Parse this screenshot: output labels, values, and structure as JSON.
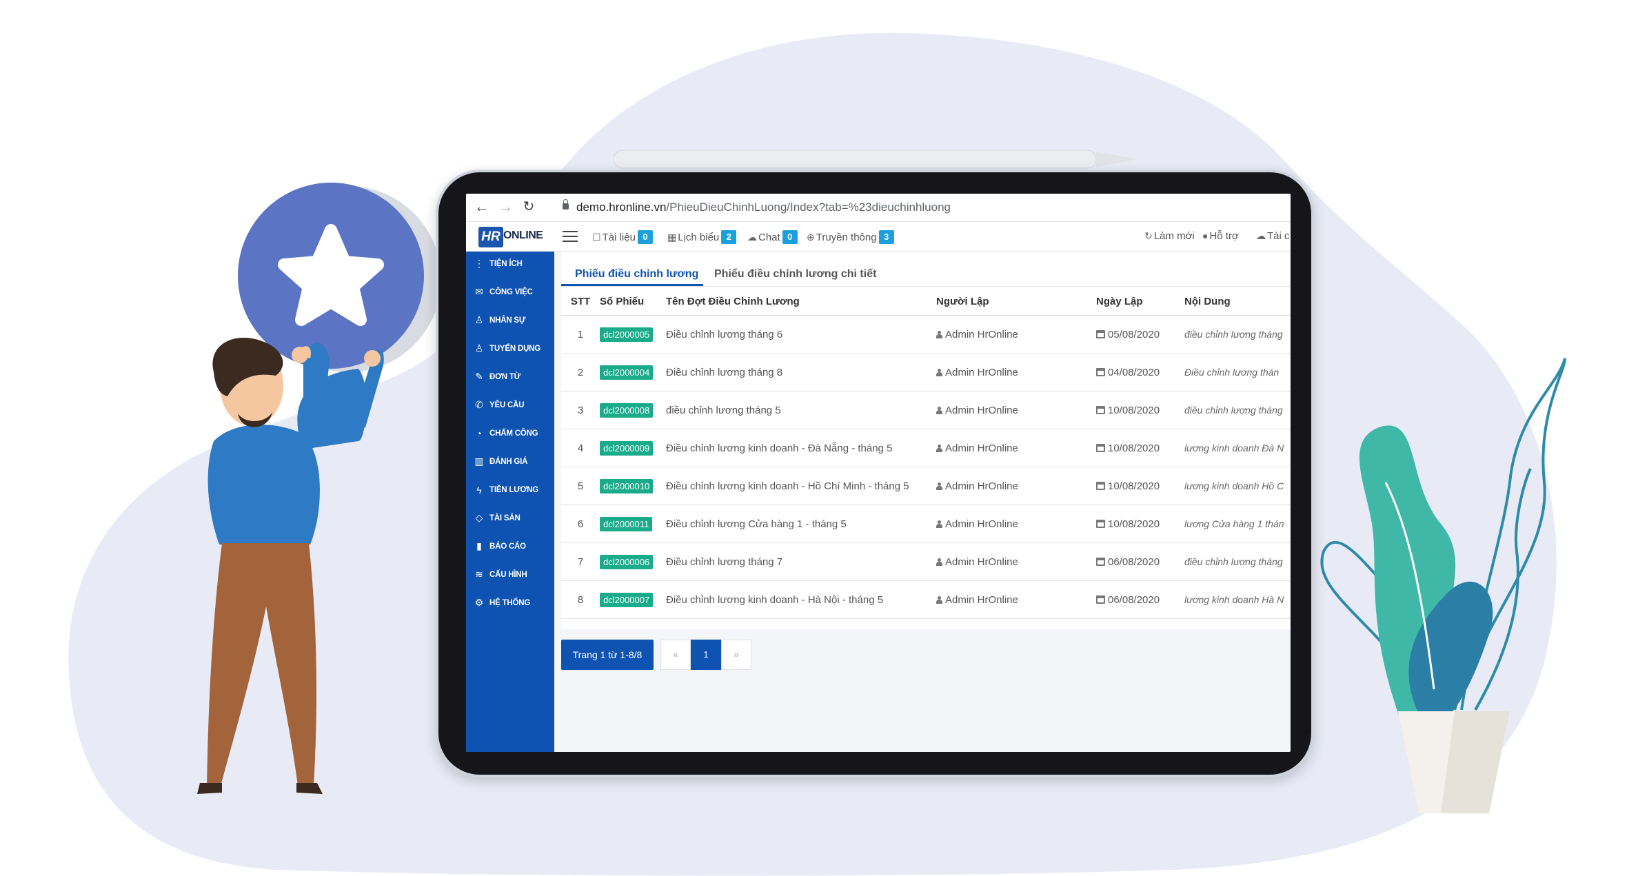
{
  "browser": {
    "url_host": "demo.hronline.vn",
    "url_path": "/PhieuDieuChinhLuong/Index?tab=%23dieuchinhluong"
  },
  "header": {
    "logo_mark": "HR",
    "logo_text": "ONLINE",
    "links": [
      {
        "label": "Tài liệu",
        "icon": "folder-icon",
        "badge": "0"
      },
      {
        "label": "Lịch biểu",
        "icon": "calendar-icon",
        "badge": "2"
      },
      {
        "label": "Chat",
        "icon": "chat-icon",
        "badge": "0"
      },
      {
        "label": "Truyền thông",
        "icon": "globe-icon",
        "badge": "3"
      }
    ],
    "right_links": [
      {
        "label": "Làm mới",
        "icon": "refresh-icon"
      },
      {
        "label": "Hỗ trợ",
        "icon": "info-icon"
      },
      {
        "label": "Tài c",
        "icon": "cloud-icon"
      }
    ]
  },
  "sidebar": {
    "items": [
      {
        "label": "Tiện ích",
        "icon": "more-vertical-icon"
      },
      {
        "label": "Công việc",
        "icon": "mail-icon"
      },
      {
        "label": "Nhân sự",
        "icon": "user-icon"
      },
      {
        "label": "Tuyển dụng",
        "icon": "user-add-icon"
      },
      {
        "label": "Đơn từ",
        "icon": "edit-icon"
      },
      {
        "label": "Yêu cầu",
        "icon": "phone-icon"
      },
      {
        "label": "Chấm công",
        "icon": "clock-icon"
      },
      {
        "label": "Đánh giá",
        "icon": "book-icon"
      },
      {
        "label": "Tiền lương",
        "icon": "bolt-icon"
      },
      {
        "label": "Tài sản",
        "icon": "diamond-icon"
      },
      {
        "label": "Báo cáo",
        "icon": "bar-chart-icon"
      },
      {
        "label": "Cấu hình",
        "icon": "layers-icon"
      },
      {
        "label": "Hệ thống",
        "icon": "gear-icon"
      }
    ]
  },
  "tabs": [
    {
      "label": "Phiếu điều chỉnh lương",
      "active": true
    },
    {
      "label": "Phiếu điều chỉnh lương chi tiết",
      "active": false
    }
  ],
  "table": {
    "headers": [
      "STT",
      "Số Phiếu",
      "Tên Đợt Điều Chỉnh Lương",
      "Người Lập",
      "Ngày Lập",
      "Nội Dung"
    ],
    "rows": [
      {
        "stt": "1",
        "code": "dcl2000005",
        "name": "Điều chỉnh lương tháng 6",
        "creator": "Admin HrOnline",
        "date": "05/08/2020",
        "content": "điều chỉnh lương tháng"
      },
      {
        "stt": "2",
        "code": "dcl2000004",
        "name": "Điều chỉnh lương tháng 8",
        "creator": "Admin HrOnline",
        "date": "04/08/2020",
        "content": "Điều chỉnh lương thán"
      },
      {
        "stt": "3",
        "code": "dcl2000008",
        "name": "điều chỉnh lương tháng 5",
        "creator": "Admin HrOnline",
        "date": "10/08/2020",
        "content": "điều chỉnh lương tháng"
      },
      {
        "stt": "4",
        "code": "dcl2000009",
        "name": "Điều chỉnh lương kinh doanh - Đà Nẵng - tháng 5",
        "creator": "Admin HrOnline",
        "date": "10/08/2020",
        "content": "lương kinh doanh Đà N"
      },
      {
        "stt": "5",
        "code": "dcl2000010",
        "name": "Điều chỉnh lương kinh doanh - Hồ Chí Minh - tháng 5",
        "creator": "Admin HrOnline",
        "date": "10/08/2020",
        "content": "lương kinh doanh Hồ C"
      },
      {
        "stt": "6",
        "code": "dcl2000011",
        "name": "Điều chỉnh lương Cửa hàng 1 - tháng 5",
        "creator": "Admin HrOnline",
        "date": "10/08/2020",
        "content": "lương Cửa hàng 1 thán"
      },
      {
        "stt": "7",
        "code": "dcl2000006",
        "name": "Điều chỉnh lương tháng 7",
        "creator": "Admin HrOnline",
        "date": "06/08/2020",
        "content": "điều chỉnh lương tháng"
      },
      {
        "stt": "8",
        "code": "dcl2000007",
        "name": "Điều chỉnh lương kinh doanh - Hà Nội - tháng 5",
        "creator": "Admin HrOnline",
        "date": "06/08/2020",
        "content": "lương kinh doanh Hà N"
      }
    ]
  },
  "pagination": {
    "info": "Trang 1 từ 1-8/8",
    "prev": "«",
    "current": "1",
    "next": "»"
  },
  "colors": {
    "brand_blue": "#0e53b2",
    "badge_blue": "#1aa0dc",
    "code_green": "#1aab8b",
    "blob_bg": "#e8ebf6",
    "star_circle": "#5b74c4"
  }
}
